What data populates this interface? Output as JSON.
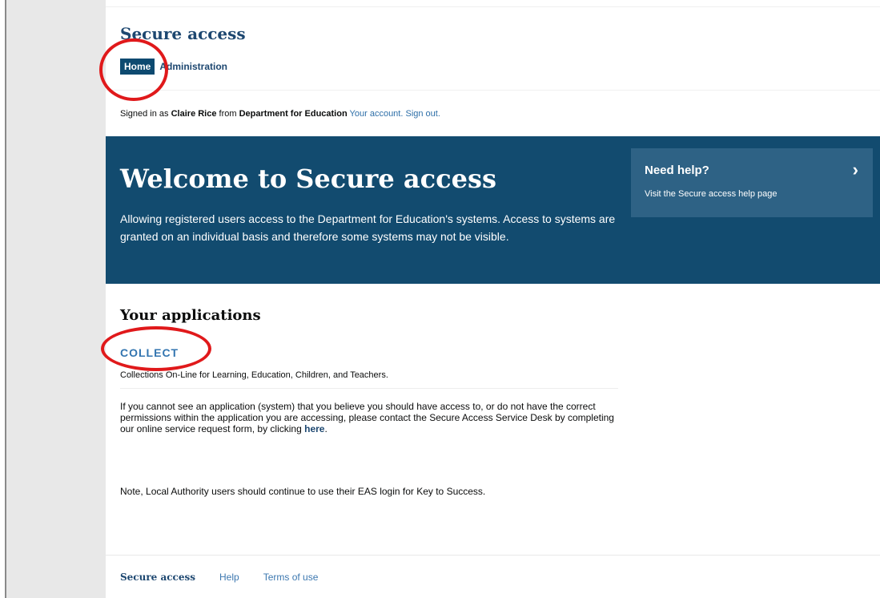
{
  "header": {
    "service_title": "Secure access",
    "nav": {
      "home": "Home",
      "administration": "Administration"
    }
  },
  "account": {
    "prefix": "Signed in as",
    "user_name": "Claire Rice",
    "from_label": "from",
    "organisation": "Department for Education",
    "your_account": "Your account.",
    "sign_out": "Sign out."
  },
  "hero": {
    "title": "Welcome to Secure access",
    "description": "Allowing registered users access to the Department for Education's systems. Access to systems are granted on an individual basis and therefore some systems may not be visible.",
    "help": {
      "title": "Need help?",
      "subtitle": "Visit the Secure access help page",
      "icon": "chevron-right-icon"
    }
  },
  "applications": {
    "heading": "Your applications",
    "items": [
      {
        "name": "COLLECT",
        "description": "Collections On-Line for Learning, Education, Children, and Teachers."
      }
    ],
    "access_note": "If you cannot see an application (system) that you believe you should have access to, or do not have the correct permissions within the application you are accessing, please contact the Secure Access Service Desk by completing our online service request form, by clicking",
    "here_link": "here",
    "la_note": "Note, Local Authority users should continue to use their EAS login for Key to Success."
  },
  "footer": {
    "title": "Secure access",
    "links": [
      "Help",
      "Terms of use"
    ]
  },
  "colors": {
    "brand_blue": "#124b6f",
    "help_box": "#2e6285",
    "link": "#3375b0",
    "annotation_red": "#e0191b"
  }
}
